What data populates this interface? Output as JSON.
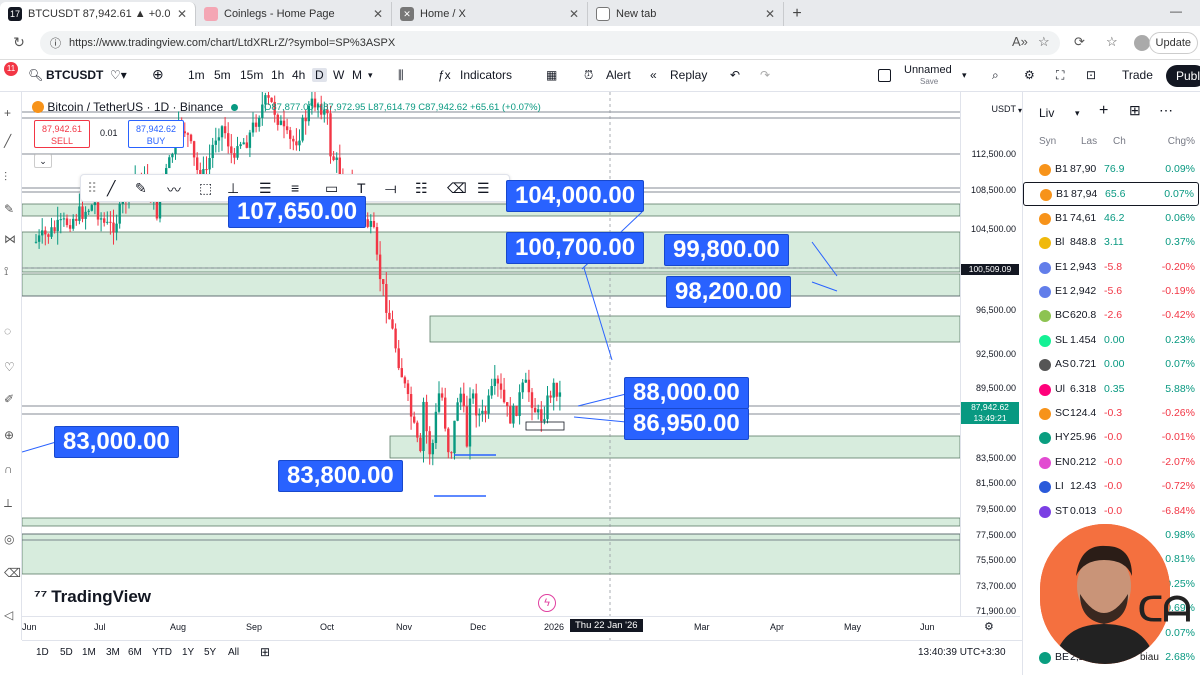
{
  "browser": {
    "tabs": [
      {
        "title": "BTCUSDT 87,942.61 ▲ +0.07% Ur",
        "active": true
      },
      {
        "title": "Coinlegs - Home Page",
        "active": false
      },
      {
        "title": "Home / X",
        "active": false
      },
      {
        "title": "New tab",
        "active": false
      }
    ],
    "url": "https://www.tradingview.com/chart/LtdXRLrZ/?symbol=SP%3ASPX",
    "update_label": "Update"
  },
  "toolbar": {
    "badge": "11",
    "symbol": "BTCUSDT",
    "intervals": [
      "1m",
      "5m",
      "15m",
      "1h",
      "4h",
      "D",
      "W",
      "M"
    ],
    "active_interval": "D",
    "indicators_label": "Indicators",
    "alert_label": "Alert",
    "replay_label": "Replay",
    "layout_name": "Unnamed",
    "layout_sub": "Save",
    "trade_label": "Trade",
    "publish_label": "Publ"
  },
  "chart_header": {
    "title": "Bitcoin / TetherUS · 1D · Binance",
    "ohlc": "O87,877.00  H87,972.95  L87,614.79  C87,942.62  +65.61 (+0.07%)",
    "sell_price": "87,942.61",
    "sell_label": "SELL",
    "spread": "0.01",
    "buy_price": "87,942.62",
    "buy_label": "BUY"
  },
  "price_axis": {
    "currency": "USDT",
    "ticks": [
      "112,500.00",
      "108,500.00",
      "104,500.00",
      "96,500.00",
      "92,500.00",
      "89,500.00",
      "83,500.00",
      "81,500.00",
      "79,500.00",
      "77,500.00",
      "75,500.00",
      "73,700.00",
      "71,900.00"
    ],
    "level_badge": "100,509.09",
    "last_price_badge": "87,942.62",
    "countdown": "13:49:21"
  },
  "time_axis": {
    "ticks": [
      "Jun",
      "Jul",
      "Aug",
      "Sep",
      "Oct",
      "Nov",
      "Dec",
      "2026",
      "Feb",
      "Mar",
      "Apr",
      "May",
      "Jun"
    ],
    "crosshair_label": "Thu 22 Jan '26"
  },
  "price_labels": {
    "l107650": "107,650.00",
    "l104000": "104,000.00",
    "l100700": "100,700.00",
    "l99800": "99,800.00",
    "l98200": "98,200.00",
    "l88000": "88,000.00",
    "l86950": "86,950.00",
    "l83000": "83,000.00",
    "l83800": "83,800.00"
  },
  "watermark": "TradingView",
  "bottom_bar": {
    "ranges": [
      "1D",
      "5D",
      "1M",
      "3M",
      "6M",
      "YTD",
      "1Y",
      "5Y",
      "All"
    ],
    "clock": "13:40:39 UTC+3:30"
  },
  "watchlist": {
    "title": "Liv",
    "columns": [
      "Syn",
      "Las",
      "Ch",
      "Chg%"
    ],
    "rows": [
      {
        "sym": "B1",
        "last": "87,90",
        "ch": "76.9",
        "pct": "0.09%",
        "dir": "up",
        "color": "#f7931a"
      },
      {
        "sym": "B1",
        "last": "87,94",
        "ch": "65.6",
        "pct": "0.07%",
        "dir": "up",
        "color": "#f7931a",
        "selected": true
      },
      {
        "sym": "B1",
        "last": "74,61",
        "ch": "46.2",
        "pct": "0.06%",
        "dir": "up",
        "color": "#f7931a"
      },
      {
        "sym": "Bl",
        "last": "848.8",
        "ch": "3.11",
        "pct": "0.37%",
        "dir": "up",
        "color": "#f0b90b"
      },
      {
        "sym": "E1",
        "last": "2,943",
        "ch": "-5.8",
        "pct": "-0.20%",
        "dir": "dn",
        "color": "#627eea"
      },
      {
        "sym": "E1",
        "last": "2,942",
        "ch": "-5.6",
        "pct": "-0.19%",
        "dir": "dn",
        "color": "#627eea"
      },
      {
        "sym": "BC",
        "last": "620.8",
        "ch": "-2.6",
        "pct": "-0.42%",
        "dir": "dn",
        "color": "#8dc351"
      },
      {
        "sym": "SL",
        "last": "1.454",
        "ch": "0.00",
        "pct": "0.23%",
        "dir": "up",
        "color": "#14f195"
      },
      {
        "sym": "AS",
        "last": "0.721",
        "ch": "0.00",
        "pct": "0.07%",
        "dir": "up",
        "color": "#555555"
      },
      {
        "sym": "Ul",
        "last": "6.318",
        "ch": "0.35",
        "pct": "5.88%",
        "dir": "up",
        "color": "#ff007a"
      },
      {
        "sym": "SC",
        "last": "124.4",
        "ch": "-0.3",
        "pct": "-0.26%",
        "dir": "dn",
        "color": "#f7931a"
      },
      {
        "sym": "HY",
        "last": "25.96",
        "ch": "-0.0",
        "pct": "-0.01%",
        "dir": "dn",
        "color": "#0a9e80"
      },
      {
        "sym": "EN",
        "last": "0.212",
        "ch": "-0.0",
        "pct": "-2.07%",
        "dir": "dn",
        "color": "#e24bd1"
      },
      {
        "sym": "LI",
        "last": "12.43",
        "ch": "-0.0",
        "pct": "-0.72%",
        "dir": "dn",
        "color": "#2a5ada"
      },
      {
        "sym": "ST",
        "last": "0.013",
        "ch": "-0.0",
        "pct": "-6.84%",
        "dir": "dn",
        "color": "#7b3fe4"
      },
      {
        "sym": "",
        "last": "",
        "ch": "",
        "pct": "0.98%",
        "dir": "up",
        "color": "#ffffff"
      },
      {
        "sym": "",
        "last": "",
        "ch": "",
        "pct": "0.81%",
        "dir": "up",
        "color": "#ffffff"
      },
      {
        "sym": "",
        "last": "",
        "ch": "",
        "pct": "0.25%",
        "dir": "up",
        "color": "#ffffff"
      },
      {
        "sym": "",
        "last": "",
        "ch": "",
        "pct": "0.69%",
        "dir": "up",
        "color": "#ffffff"
      },
      {
        "sym": "",
        "last": "",
        "ch": "",
        "pct": "0.07%",
        "dir": "up",
        "color": "#ffffff"
      },
      {
        "sym": "BE",
        "last": "2,26",
        "ch": "0.05",
        "pct": "2.68%",
        "dir": "up",
        "color": "#0a9e80"
      }
    ]
  },
  "webcam_brand": "biau",
  "colors": {
    "accent": "#2962ff",
    "up": "#089981",
    "down": "#f23645",
    "zone": "#d7ecdd"
  }
}
